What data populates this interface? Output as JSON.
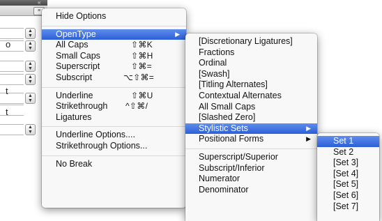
{
  "panel": {
    "collapse_icon": "double-chevron-icon",
    "menu_icon": "panel-menu-icon",
    "fragments": [
      "o",
      "t",
      "t"
    ]
  },
  "main_menu": {
    "items": [
      {
        "label": "Hide Options",
        "shortcut": ""
      },
      {
        "label": "OpenType",
        "shortcut": "",
        "submenu": true,
        "selected": true
      },
      {
        "label": "All Caps",
        "shortcut": "⇧⌘K"
      },
      {
        "label": "Small Caps",
        "shortcut": "⇧⌘H"
      },
      {
        "label": "Superscript",
        "shortcut": "⇧⌘="
      },
      {
        "label": "Subscript",
        "shortcut": "⌥⇧⌘="
      },
      {
        "label": "Underline",
        "shortcut": "⇧⌘U"
      },
      {
        "label": "Strikethrough",
        "shortcut": "^⇧⌘/"
      },
      {
        "label": "Ligatures",
        "shortcut": ""
      },
      {
        "label": "Underline Options....",
        "shortcut": ""
      },
      {
        "label": "Strikethrough Options...",
        "shortcut": ""
      },
      {
        "label": "No Break",
        "shortcut": ""
      }
    ]
  },
  "opentype_menu": {
    "items": [
      {
        "label": "[Discretionary Ligatures]"
      },
      {
        "label": "Fractions"
      },
      {
        "label": "Ordinal"
      },
      {
        "label": "[Swash]"
      },
      {
        "label": "[Titling Alternates]"
      },
      {
        "label": "Contextual Alternates"
      },
      {
        "label": "All Small Caps"
      },
      {
        "label": "[Slashed Zero]"
      },
      {
        "label": "Stylistic Sets",
        "submenu": true,
        "selected": true
      },
      {
        "label": "Positional Forms",
        "submenu": true
      },
      {
        "label": "Superscript/Superior"
      },
      {
        "label": "Subscript/Inferior"
      },
      {
        "label": "Numerator"
      },
      {
        "label": "Denominator"
      }
    ]
  },
  "stylistic_sets_menu": {
    "items": [
      {
        "label": "Set 1",
        "selected": true
      },
      {
        "label": "Set 2"
      },
      {
        "label": "[Set 3]"
      },
      {
        "label": "[Set 4]"
      },
      {
        "label": "[Set 5]"
      },
      {
        "label": "[Set 6]"
      },
      {
        "label": "[Set 7]"
      }
    ]
  },
  "colors": {
    "selection": "#2c5fd8",
    "menu_bg": "#f8f8f8"
  }
}
